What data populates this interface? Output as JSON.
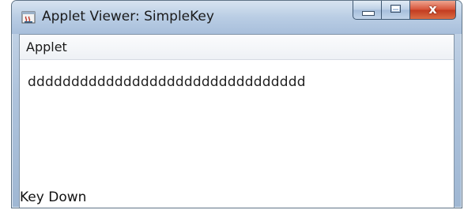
{
  "window": {
    "title": "Applet Viewer: SimpleKey",
    "icon": "java-applet-icon",
    "controls": {
      "minimize": "minimize-icon",
      "maximize": "maximize-icon",
      "close_label": "x"
    }
  },
  "menubar": {
    "items": [
      {
        "label": "Applet"
      }
    ]
  },
  "applet": {
    "typed_text": "dddddddddddddddddddddddddddddddd",
    "status_text": "Key Down"
  },
  "colors": {
    "titlebar": "#b9cde4",
    "close_button": "#c23b20",
    "client_background": "#ffffff"
  }
}
